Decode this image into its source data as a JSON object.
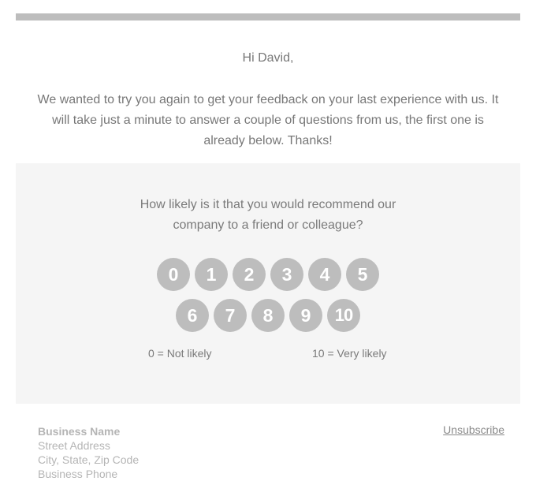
{
  "greeting": "Hi David,",
  "intro": "We wanted to try you again to get your feedback on your last experience with us. It will take just a minute to answer a couple of questions from us, the first one is already below. Thanks!",
  "survey": {
    "question_line1": "How likely is it that you would recommend our",
    "question_line2": "company to a friend or colleague?",
    "scores": [
      "0",
      "1",
      "2",
      "3",
      "4",
      "5",
      "6",
      "7",
      "8",
      "9",
      "10"
    ],
    "low_label": "0 = Not likely",
    "high_label": "10 = Very likely"
  },
  "footer": {
    "business_name": "Business Name",
    "street": "Street Address",
    "city": "City, State, Zip Code",
    "phone": "Business Phone",
    "unsubscribe": "Unsubscribe"
  },
  "colors": {
    "bar": "#bdbdbd",
    "survey_background": "#f5f5f5",
    "score_button": "#bdbdbd",
    "text": "#777777"
  }
}
